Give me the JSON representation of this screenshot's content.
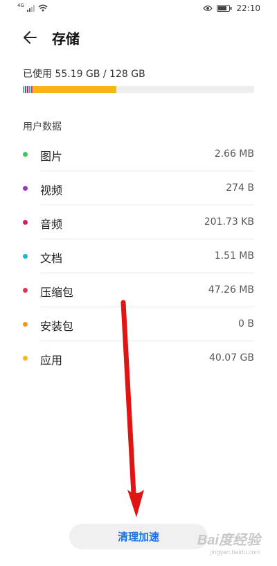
{
  "statusbar": {
    "network": "4G",
    "time": "22:10",
    "icons": [
      "signal-icon",
      "wifi-icon",
      "eye-icon",
      "battery-icon"
    ]
  },
  "header": {
    "title": "存储",
    "back_icon": "arrow-left-icon"
  },
  "storage": {
    "usage_text": "已使用 55.19 GB / 128 GB",
    "used_fraction": 0.431,
    "segments": [
      {
        "name": "images",
        "color": "#3ec65a",
        "fraction": 0.008
      },
      {
        "name": "video",
        "color": "#9b35c4",
        "fraction": 0.008
      },
      {
        "name": "audio",
        "color": "#d61a74",
        "fraction": 0.008
      },
      {
        "name": "docs",
        "color": "#1cb8cf",
        "fraction": 0.008
      },
      {
        "name": "archives",
        "color": "#e5334b",
        "fraction": 0.008
      },
      {
        "name": "apps",
        "color": "#f6b714",
        "fraction": 0.36
      }
    ]
  },
  "section_title": "用户数据",
  "items": [
    {
      "label": "图片",
      "value": "2.66 MB",
      "color": "#3ec65a"
    },
    {
      "label": "视频",
      "value": "274 B",
      "color": "#9b35c4"
    },
    {
      "label": "音频",
      "value": "201.73 KB",
      "color": "#d61a74"
    },
    {
      "label": "文档",
      "value": "1.51 MB",
      "color": "#1cb8cf"
    },
    {
      "label": "压缩包",
      "value": "47.26 MB",
      "color": "#e5334b"
    },
    {
      "label": "安装包",
      "value": "0 B",
      "color": "#f39a1a"
    },
    {
      "label": "应用",
      "value": "40.07 GB",
      "color": "#f6b714"
    }
  ],
  "clean_button": "清理加速",
  "watermark": {
    "line1": "Bai度经验",
    "line2": "jingyan.baidu.com"
  }
}
